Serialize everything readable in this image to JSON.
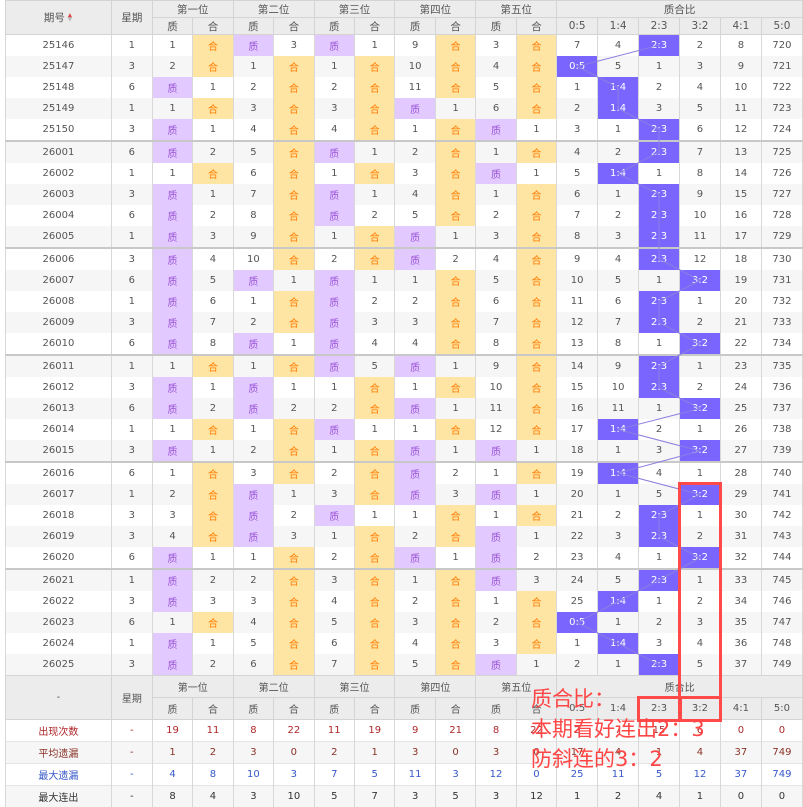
{
  "header": {
    "period": "期号",
    "weekday": "星期",
    "positions": [
      "第一位",
      "第二位",
      "第三位",
      "第四位",
      "第五位"
    ],
    "sub": [
      "质",
      "合"
    ],
    "ratio_title": "质合比",
    "ratios": [
      "0:5",
      "1:4",
      "2:3",
      "3:2",
      "4:1",
      "5:0"
    ]
  },
  "colors": {
    "prime_bg": "#e2c9ff",
    "prime_text": "#9b55d6",
    "composite_bg": "#ffe5a3",
    "composite_text": "#ff7a00",
    "ratio_hit": "#7a66ff",
    "annotation": "#ff4646"
  },
  "rows": [
    {
      "p": "25146",
      "w": "1",
      "pos": [
        [
          "1",
          "合"
        ],
        [
          "质",
          "3"
        ],
        [
          "质",
          "1"
        ],
        [
          "9",
          "合"
        ],
        [
          "3",
          "合"
        ]
      ],
      "r": [
        "7",
        "4",
        "2:3",
        "2",
        "8",
        "720"
      ]
    },
    {
      "p": "25147",
      "w": "3",
      "pos": [
        [
          "2",
          "合"
        ],
        [
          "1",
          "合"
        ],
        [
          "1",
          "合"
        ],
        [
          "10",
          "合"
        ],
        [
          "4",
          "合"
        ]
      ],
      "r": [
        "0:5",
        "5",
        "1",
        "3",
        "9",
        "721"
      ]
    },
    {
      "p": "25148",
      "w": "6",
      "pos": [
        [
          "质",
          "1"
        ],
        [
          "2",
          "合"
        ],
        [
          "2",
          "合"
        ],
        [
          "11",
          "合"
        ],
        [
          "5",
          "合"
        ]
      ],
      "r": [
        "1",
        "1:4",
        "2",
        "4",
        "10",
        "722"
      ]
    },
    {
      "p": "25149",
      "w": "1",
      "pos": [
        [
          "1",
          "合"
        ],
        [
          "3",
          "合"
        ],
        [
          "3",
          "合"
        ],
        [
          "质",
          "1"
        ],
        [
          "6",
          "合"
        ]
      ],
      "r": [
        "2",
        "1:4",
        "3",
        "5",
        "11",
        "723"
      ]
    },
    {
      "p": "25150",
      "w": "3",
      "pos": [
        [
          "质",
          "1"
        ],
        [
          "4",
          "合"
        ],
        [
          "4",
          "合"
        ],
        [
          "1",
          "合"
        ],
        [
          "质",
          "1"
        ]
      ],
      "r": [
        "3",
        "1",
        "2:3",
        "6",
        "12",
        "724"
      ]
    },
    {
      "p": "26001",
      "w": "6",
      "pos": [
        [
          "质",
          "2"
        ],
        [
          "5",
          "合"
        ],
        [
          "质",
          "1"
        ],
        [
          "2",
          "合"
        ],
        [
          "1",
          "合"
        ]
      ],
      "r": [
        "4",
        "2",
        "2:3",
        "7",
        "13",
        "725"
      ]
    },
    {
      "p": "26002",
      "w": "1",
      "pos": [
        [
          "1",
          "合"
        ],
        [
          "6",
          "合"
        ],
        [
          "1",
          "合"
        ],
        [
          "3",
          "合"
        ],
        [
          "质",
          "1"
        ]
      ],
      "r": [
        "5",
        "1:4",
        "1",
        "8",
        "14",
        "726"
      ]
    },
    {
      "p": "26003",
      "w": "3",
      "pos": [
        [
          "质",
          "1"
        ],
        [
          "7",
          "合"
        ],
        [
          "质",
          "1"
        ],
        [
          "4",
          "合"
        ],
        [
          "1",
          "合"
        ]
      ],
      "r": [
        "6",
        "1",
        "2:3",
        "9",
        "15",
        "727"
      ]
    },
    {
      "p": "26004",
      "w": "6",
      "pos": [
        [
          "质",
          "2"
        ],
        [
          "8",
          "合"
        ],
        [
          "质",
          "2"
        ],
        [
          "5",
          "合"
        ],
        [
          "2",
          "合"
        ]
      ],
      "r": [
        "7",
        "2",
        "2:3",
        "10",
        "16",
        "728"
      ]
    },
    {
      "p": "26005",
      "w": "1",
      "pos": [
        [
          "质",
          "3"
        ],
        [
          "9",
          "合"
        ],
        [
          "1",
          "合"
        ],
        [
          "质",
          "1"
        ],
        [
          "3",
          "合"
        ]
      ],
      "r": [
        "8",
        "3",
        "2:3",
        "11",
        "17",
        "729"
      ]
    },
    {
      "p": "26006",
      "w": "3",
      "pos": [
        [
          "质",
          "4"
        ],
        [
          "10",
          "合"
        ],
        [
          "2",
          "合"
        ],
        [
          "质",
          "2"
        ],
        [
          "4",
          "合"
        ]
      ],
      "r": [
        "9",
        "4",
        "2:3",
        "12",
        "18",
        "730"
      ]
    },
    {
      "p": "26007",
      "w": "6",
      "pos": [
        [
          "质",
          "5"
        ],
        [
          "质",
          "1"
        ],
        [
          "质",
          "1"
        ],
        [
          "1",
          "合"
        ],
        [
          "5",
          "合"
        ]
      ],
      "r": [
        "10",
        "5",
        "1",
        "3:2",
        "19",
        "731"
      ]
    },
    {
      "p": "26008",
      "w": "1",
      "pos": [
        [
          "质",
          "6"
        ],
        [
          "1",
          "合"
        ],
        [
          "质",
          "2"
        ],
        [
          "2",
          "合"
        ],
        [
          "6",
          "合"
        ]
      ],
      "r": [
        "11",
        "6",
        "2:3",
        "1",
        "20",
        "732"
      ]
    },
    {
      "p": "26009",
      "w": "3",
      "pos": [
        [
          "质",
          "7"
        ],
        [
          "2",
          "合"
        ],
        [
          "质",
          "3"
        ],
        [
          "3",
          "合"
        ],
        [
          "7",
          "合"
        ]
      ],
      "r": [
        "12",
        "7",
        "2:3",
        "2",
        "21",
        "733"
      ]
    },
    {
      "p": "26010",
      "w": "6",
      "pos": [
        [
          "质",
          "8"
        ],
        [
          "质",
          "1"
        ],
        [
          "质",
          "4"
        ],
        [
          "4",
          "合"
        ],
        [
          "8",
          "合"
        ]
      ],
      "r": [
        "13",
        "8",
        "1",
        "3:2",
        "22",
        "734"
      ]
    },
    {
      "p": "26011",
      "w": "1",
      "pos": [
        [
          "1",
          "合"
        ],
        [
          "1",
          "合"
        ],
        [
          "质",
          "5"
        ],
        [
          "质",
          "1"
        ],
        [
          "9",
          "合"
        ]
      ],
      "r": [
        "14",
        "9",
        "2:3",
        "1",
        "23",
        "735"
      ]
    },
    {
      "p": "26012",
      "w": "3",
      "pos": [
        [
          "质",
          "1"
        ],
        [
          "质",
          "1"
        ],
        [
          "1",
          "合"
        ],
        [
          "1",
          "合"
        ],
        [
          "10",
          "合"
        ]
      ],
      "r": [
        "15",
        "10",
        "2:3",
        "2",
        "24",
        "736"
      ]
    },
    {
      "p": "26013",
      "w": "6",
      "pos": [
        [
          "质",
          "2"
        ],
        [
          "质",
          "2"
        ],
        [
          "2",
          "合"
        ],
        [
          "质",
          "1"
        ],
        [
          "11",
          "合"
        ]
      ],
      "r": [
        "16",
        "11",
        "1",
        "3:2",
        "25",
        "737"
      ]
    },
    {
      "p": "26014",
      "w": "1",
      "pos": [
        [
          "1",
          "合"
        ],
        [
          "1",
          "合"
        ],
        [
          "质",
          "1"
        ],
        [
          "1",
          "合"
        ],
        [
          "12",
          "合"
        ]
      ],
      "r": [
        "17",
        "1:4",
        "2",
        "1",
        "26",
        "738"
      ]
    },
    {
      "p": "26015",
      "w": "3",
      "pos": [
        [
          "质",
          "1"
        ],
        [
          "2",
          "合"
        ],
        [
          "1",
          "合"
        ],
        [
          "质",
          "1"
        ],
        [
          "质",
          "1"
        ]
      ],
      "r": [
        "18",
        "1",
        "3",
        "3:2",
        "27",
        "739"
      ]
    },
    {
      "p": "26016",
      "w": "6",
      "pos": [
        [
          "1",
          "合"
        ],
        [
          "3",
          "合"
        ],
        [
          "2",
          "合"
        ],
        [
          "质",
          "2"
        ],
        [
          "1",
          "合"
        ]
      ],
      "r": [
        "19",
        "1:4",
        "4",
        "1",
        "28",
        "740"
      ]
    },
    {
      "p": "26017",
      "w": "1",
      "pos": [
        [
          "2",
          "合"
        ],
        [
          "质",
          "1"
        ],
        [
          "3",
          "合"
        ],
        [
          "质",
          "3"
        ],
        [
          "质",
          "1"
        ]
      ],
      "r": [
        "20",
        "1",
        "5",
        "3:2",
        "29",
        "741"
      ]
    },
    {
      "p": "26018",
      "w": "3",
      "pos": [
        [
          "3",
          "合"
        ],
        [
          "质",
          "2"
        ],
        [
          "质",
          "1"
        ],
        [
          "1",
          "合"
        ],
        [
          "1",
          "合"
        ]
      ],
      "r": [
        "21",
        "2",
        "2:3",
        "1",
        "30",
        "742"
      ]
    },
    {
      "p": "26019",
      "w": "3",
      "pos": [
        [
          "4",
          "合"
        ],
        [
          "质",
          "3"
        ],
        [
          "1",
          "合"
        ],
        [
          "2",
          "合"
        ],
        [
          "质",
          "1"
        ]
      ],
      "r": [
        "22",
        "3",
        "2:3",
        "2",
        "31",
        "743"
      ]
    },
    {
      "p": "26020",
      "w": "6",
      "pos": [
        [
          "质",
          "1"
        ],
        [
          "1",
          "合"
        ],
        [
          "2",
          "合"
        ],
        [
          "质",
          "1"
        ],
        [
          "质",
          "2"
        ]
      ],
      "r": [
        "23",
        "4",
        "1",
        "3:2",
        "32",
        "744"
      ]
    },
    {
      "p": "26021",
      "w": "1",
      "pos": [
        [
          "质",
          "2"
        ],
        [
          "2",
          "合"
        ],
        [
          "3",
          "合"
        ],
        [
          "1",
          "合"
        ],
        [
          "质",
          "3"
        ]
      ],
      "r": [
        "24",
        "5",
        "2:3",
        "1",
        "33",
        "745"
      ]
    },
    {
      "p": "26022",
      "w": "3",
      "pos": [
        [
          "质",
          "3"
        ],
        [
          "3",
          "合"
        ],
        [
          "4",
          "合"
        ],
        [
          "2",
          "合"
        ],
        [
          "1",
          "合"
        ]
      ],
      "r": [
        "25",
        "1:4",
        "1",
        "2",
        "34",
        "746"
      ]
    },
    {
      "p": "26023",
      "w": "6",
      "pos": [
        [
          "1",
          "合"
        ],
        [
          "4",
          "合"
        ],
        [
          "5",
          "合"
        ],
        [
          "3",
          "合"
        ],
        [
          "2",
          "合"
        ]
      ],
      "r": [
        "0:5",
        "1",
        "2",
        "3",
        "35",
        "747"
      ]
    },
    {
      "p": "26024",
      "w": "1",
      "pos": [
        [
          "质",
          "1"
        ],
        [
          "5",
          "合"
        ],
        [
          "6",
          "合"
        ],
        [
          "4",
          "合"
        ],
        [
          "3",
          "合"
        ]
      ],
      "r": [
        "1",
        "1:4",
        "3",
        "4",
        "36",
        "748"
      ]
    },
    {
      "p": "26025",
      "w": "3",
      "pos": [
        [
          "质",
          "2"
        ],
        [
          "6",
          "合"
        ],
        [
          "7",
          "合"
        ],
        [
          "5",
          "合"
        ],
        [
          "质",
          "1"
        ]
      ],
      "r": [
        "2",
        "1",
        "2:3",
        "5",
        "37",
        "749"
      ]
    }
  ],
  "footer": {
    "period": "-",
    "weekday": "星期",
    "stats": [
      {
        "label": "出现次数",
        "w": "-",
        "v": [
          "19",
          "11",
          "8",
          "22",
          "11",
          "19",
          "9",
          "21",
          "8",
          "22",
          "2",
          "7",
          "15",
          "6",
          "0",
          "0"
        ]
      },
      {
        "label": "平均遗漏",
        "w": "-",
        "v": [
          "1",
          "2",
          "3",
          "0",
          "2",
          "1",
          "3",
          "0",
          "3",
          "0",
          "17",
          "4",
          "1",
          "4",
          "37",
          "749"
        ]
      },
      {
        "label": "最大遗漏",
        "w": "-",
        "v": [
          "4",
          "8",
          "10",
          "3",
          "7",
          "5",
          "11",
          "3",
          "12",
          "0",
          "25",
          "11",
          "5",
          "12",
          "37",
          "749"
        ]
      },
      {
        "label": "最大连出",
        "w": "-",
        "v": [
          "8",
          "4",
          "3",
          "10",
          "5",
          "7",
          "3",
          "5",
          "3",
          "12",
          "1",
          "2",
          "4",
          "1",
          "0",
          "0"
        ]
      }
    ]
  },
  "annotation": {
    "lines": [
      "质合比：",
      "本期看好连出2：3",
      "防斜连的3：2"
    ]
  }
}
